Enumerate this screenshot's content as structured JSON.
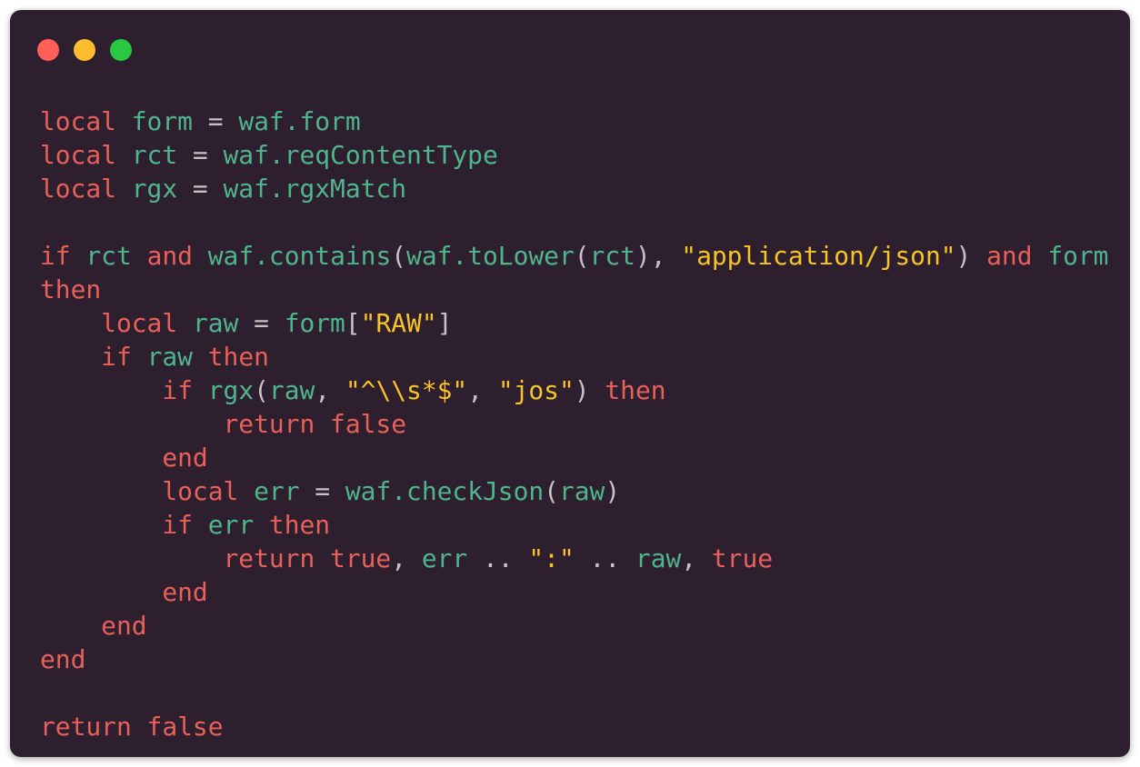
{
  "colors": {
    "background": "#2e1f2f",
    "keyword": "#e8605a",
    "identifier": "#4fb58c",
    "string": "#f7c325",
    "punctuation": "#c9c0c4"
  },
  "window_controls": [
    "close",
    "minimize",
    "maximize"
  ],
  "code": {
    "language": "lua",
    "lines": [
      [
        [
          "k",
          "local"
        ],
        [
          "p",
          " "
        ],
        [
          "v",
          "form"
        ],
        [
          "p",
          " = "
        ],
        [
          "v",
          "waf.form"
        ]
      ],
      [
        [
          "k",
          "local"
        ],
        [
          "p",
          " "
        ],
        [
          "v",
          "rct"
        ],
        [
          "p",
          " = "
        ],
        [
          "v",
          "waf.reqContentType"
        ]
      ],
      [
        [
          "k",
          "local"
        ],
        [
          "p",
          " "
        ],
        [
          "v",
          "rgx"
        ],
        [
          "p",
          " = "
        ],
        [
          "v",
          "waf.rgxMatch"
        ]
      ],
      [],
      [
        [
          "k",
          "if"
        ],
        [
          "p",
          " "
        ],
        [
          "v",
          "rct"
        ],
        [
          "p",
          " "
        ],
        [
          "k",
          "and"
        ],
        [
          "p",
          " "
        ],
        [
          "v",
          "waf.contains"
        ],
        [
          "p",
          "("
        ],
        [
          "v",
          "waf.toLower"
        ],
        [
          "p",
          "("
        ],
        [
          "v",
          "rct"
        ],
        [
          "p",
          "), "
        ],
        [
          "s",
          "\"application/json\""
        ],
        [
          "p",
          ") "
        ],
        [
          "k",
          "and"
        ],
        [
          "p",
          " "
        ],
        [
          "v",
          "form"
        ]
      ],
      [
        [
          "k",
          "then"
        ]
      ],
      [
        [
          "p",
          "    "
        ],
        [
          "k",
          "local"
        ],
        [
          "p",
          " "
        ],
        [
          "v",
          "raw"
        ],
        [
          "p",
          " = "
        ],
        [
          "v",
          "form"
        ],
        [
          "p",
          "["
        ],
        [
          "s",
          "\"RAW\""
        ],
        [
          "p",
          "]"
        ]
      ],
      [
        [
          "p",
          "    "
        ],
        [
          "k",
          "if"
        ],
        [
          "p",
          " "
        ],
        [
          "v",
          "raw"
        ],
        [
          "p",
          " "
        ],
        [
          "k",
          "then"
        ]
      ],
      [
        [
          "p",
          "        "
        ],
        [
          "k",
          "if"
        ],
        [
          "p",
          " "
        ],
        [
          "v",
          "rgx"
        ],
        [
          "p",
          "("
        ],
        [
          "v",
          "raw"
        ],
        [
          "p",
          ", "
        ],
        [
          "s",
          "\"^\\\\s*$\""
        ],
        [
          "p",
          ", "
        ],
        [
          "s",
          "\"jos\""
        ],
        [
          "p",
          ") "
        ],
        [
          "k",
          "then"
        ]
      ],
      [
        [
          "p",
          "            "
        ],
        [
          "k",
          "return"
        ],
        [
          "p",
          " "
        ],
        [
          "k",
          "false"
        ]
      ],
      [
        [
          "p",
          "        "
        ],
        [
          "k",
          "end"
        ]
      ],
      [
        [
          "p",
          "        "
        ],
        [
          "k",
          "local"
        ],
        [
          "p",
          " "
        ],
        [
          "v",
          "err"
        ],
        [
          "p",
          " = "
        ],
        [
          "v",
          "waf.checkJson"
        ],
        [
          "p",
          "("
        ],
        [
          "v",
          "raw"
        ],
        [
          "p",
          ")"
        ]
      ],
      [
        [
          "p",
          "        "
        ],
        [
          "k",
          "if"
        ],
        [
          "p",
          " "
        ],
        [
          "v",
          "err"
        ],
        [
          "p",
          " "
        ],
        [
          "k",
          "then"
        ]
      ],
      [
        [
          "p",
          "            "
        ],
        [
          "k",
          "return"
        ],
        [
          "p",
          " "
        ],
        [
          "k",
          "true"
        ],
        [
          "p",
          ", "
        ],
        [
          "v",
          "err"
        ],
        [
          "p",
          " .. "
        ],
        [
          "s",
          "\":\""
        ],
        [
          "p",
          " .. "
        ],
        [
          "v",
          "raw"
        ],
        [
          "p",
          ", "
        ],
        [
          "k",
          "true"
        ]
      ],
      [
        [
          "p",
          "        "
        ],
        [
          "k",
          "end"
        ]
      ],
      [
        [
          "p",
          "    "
        ],
        [
          "k",
          "end"
        ]
      ],
      [
        [
          "k",
          "end"
        ]
      ],
      [],
      [
        [
          "k",
          "return"
        ],
        [
          "p",
          " "
        ],
        [
          "k",
          "false"
        ]
      ]
    ]
  }
}
